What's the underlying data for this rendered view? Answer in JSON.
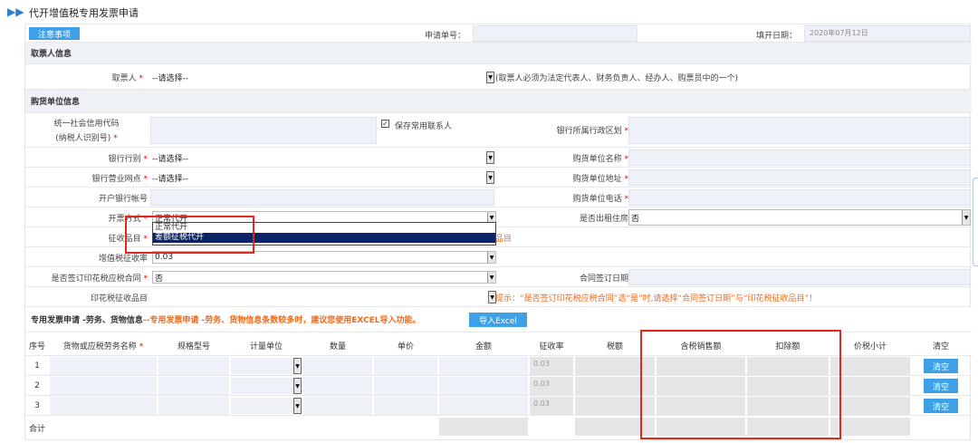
{
  "page": {
    "title": "代开增值税专用发票申请"
  },
  "toolbar": {
    "notice_label": "注意事项",
    "apply_no_label": "申请单号：",
    "fill_date_label": "填开日期：",
    "fill_date_value": "2020年07月12日"
  },
  "section1": {
    "title": "取票人信息",
    "picker_label": "取票人",
    "picker_value": "--请选择--",
    "picker_hint": "(取票人必须为法定代表人、财务负责人、经办人、购票员中的一个)"
  },
  "section2": {
    "title": "购货单位信息",
    "credit_code_label_1": "统一社会信用代码",
    "credit_code_label_2": "(纳税人识别号)",
    "save_contact_label": "保存常用联系人",
    "bank_region_label": "银行所属行政区划",
    "bank_type_label": "银行行别",
    "bank_type_value": "--请选择--",
    "buyer_name_label": "购货单位名称",
    "bank_branch_label": "银行营业网点",
    "bank_branch_value": "--请选择--",
    "buyer_addr_label": "购货单位地址",
    "account_label": "开户银行帐号",
    "buyer_phone_label": "购货单位电话",
    "issue_mode_label": "开票方式",
    "issue_mode_value": "正常代开",
    "issue_mode_options": [
      "正常代开",
      "差额征税代开"
    ],
    "rent_label": "是否出租住房",
    "rent_value": "否",
    "levy_item_label": "征收品目",
    "levy_item_trail": "品目",
    "vat_rate_label": "增值税征收率",
    "vat_rate_value": "0.03",
    "stamp_contract_label": "是否签订印花税应税合同",
    "stamp_contract_value": "否",
    "contract_date_label": "合同签订日期",
    "stamp_item_label": "印花税征收品目",
    "stamp_hint": "提示：“是否签订印花税应税合同”选“是”时,请选择“合同签订日期”与“印花税征收品目”！"
  },
  "section3": {
    "title": "专用发票申请 -劳务、货物信息",
    "notice": "--专用发票申请 -劳务、货物信息条数较多时，建议您使用EXCEL导入功能。",
    "import_label": "导入Excel",
    "columns": [
      "序号",
      "货物或应税劳务名称",
      "规格型号",
      "计量单位",
      "数量",
      "单价",
      "金额",
      "征收率",
      "税额",
      "含税销售额",
      "扣除额",
      "价税小计",
      "清空"
    ],
    "rows": [
      {
        "no": "1",
        "rate": "0.03",
        "clear": "清空"
      },
      {
        "no": "2",
        "rate": "0.03",
        "clear": "清空"
      },
      {
        "no": "3",
        "rate": "0.03",
        "clear": "清空"
      }
    ],
    "total_label": "合计"
  },
  "colors": {
    "accent": "#3ea0e6",
    "field_bg": "#eef2f8",
    "section_bg": "#eef2f7",
    "highlight": "#e0281e",
    "warning": "#ee6a1c"
  }
}
